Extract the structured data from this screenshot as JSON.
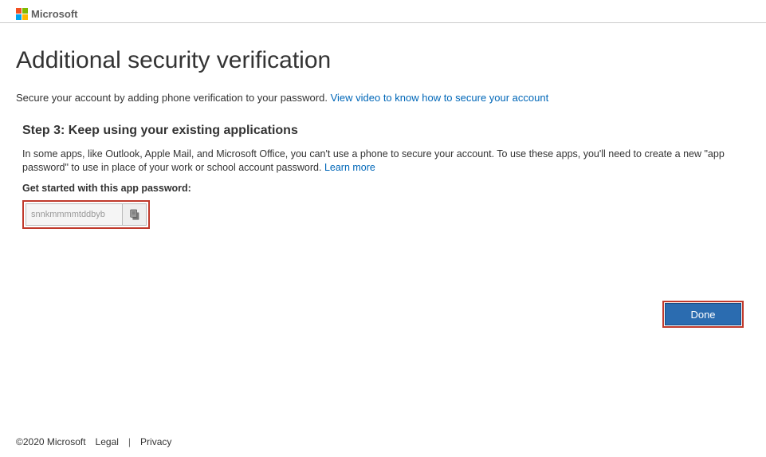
{
  "header": {
    "brand": "Microsoft"
  },
  "page": {
    "title": "Additional security verification",
    "intro_text": "Secure your account by adding phone verification to your password. ",
    "intro_link": "View video to know how to secure your account"
  },
  "step": {
    "title": "Step 3: Keep using your existing applications",
    "desc": "In some apps, like Outlook, Apple Mail, and Microsoft Office, you can't use a phone to secure your account. To use these apps, you'll need to create a new \"app password\" to use in place of your work or school account password. ",
    "learn_more": "Learn more",
    "get_started_label": "Get started with this app password:",
    "app_password_value": "snnkmmmmtddbyb"
  },
  "actions": {
    "done_label": "Done"
  },
  "footer": {
    "copyright": "©2020 Microsoft",
    "legal": "Legal",
    "privacy": "Privacy"
  }
}
